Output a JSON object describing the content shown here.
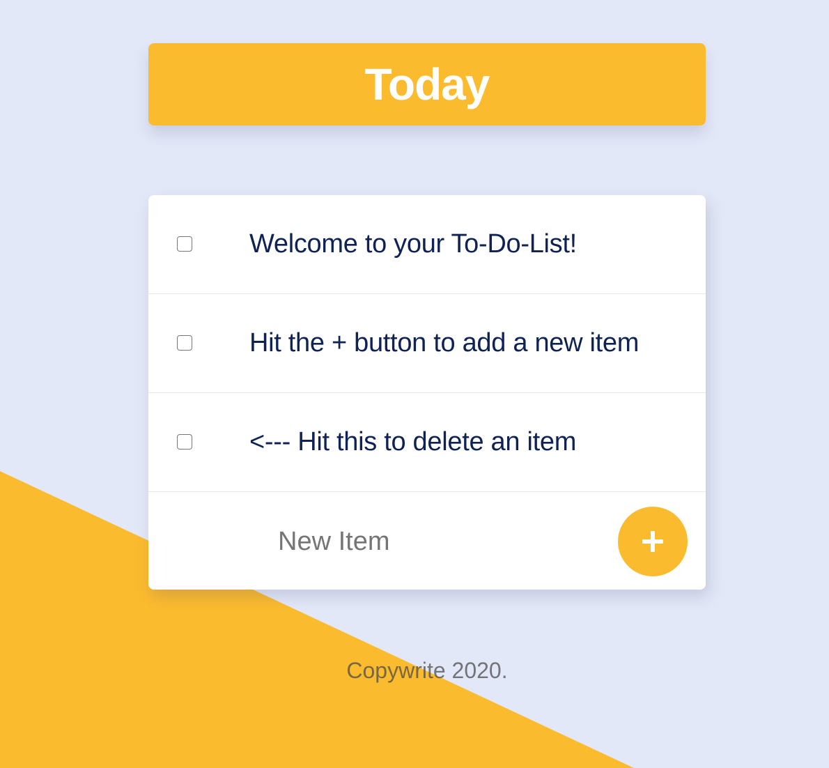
{
  "colors": {
    "background": "#e3e8f8",
    "accent": "#fbbb2f",
    "card": "#ffffff",
    "item_text": "#0f2254"
  },
  "header": {
    "title": "Today"
  },
  "list": {
    "items": [
      {
        "label": "Welcome to your To-Do-List!",
        "checked": false
      },
      {
        "label": "Hit the + button to add a new item",
        "checked": false
      },
      {
        "label": "<--- Hit this to delete an item",
        "checked": false
      }
    ],
    "new_item": {
      "placeholder": "New Item",
      "value": "",
      "add_icon": "plus-icon"
    }
  },
  "footer": {
    "text": "Copywrite 2020."
  }
}
